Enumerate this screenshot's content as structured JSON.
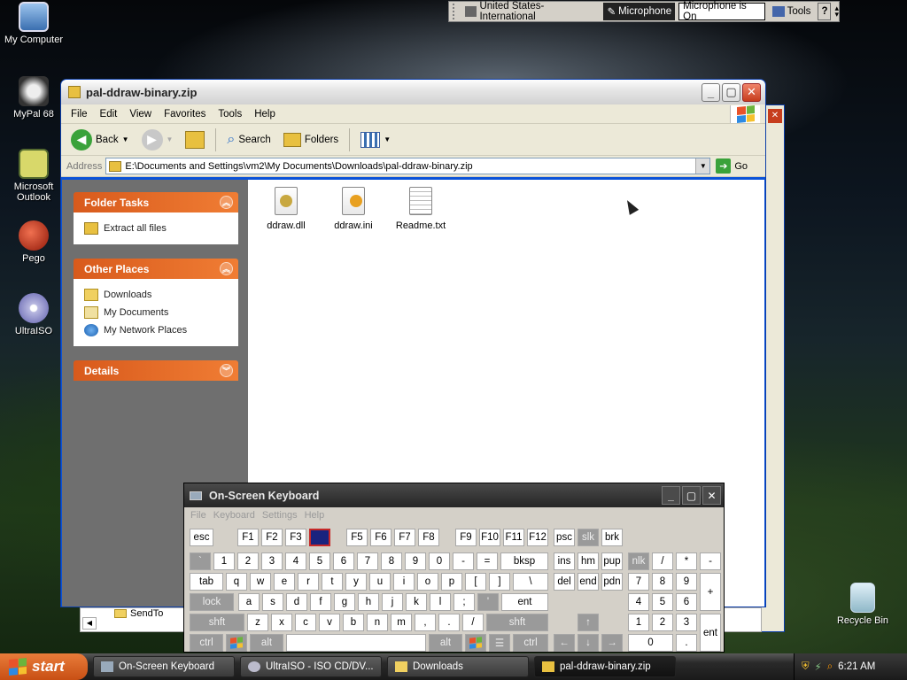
{
  "language_bar": {
    "language": "United States-International",
    "microphone_label": "Microphone",
    "microphone_status": "Microphone is On",
    "tools_label": "Tools",
    "help_glyph": "?"
  },
  "desktop": {
    "icons": [
      {
        "label": "My Computer",
        "icon": "computer-icon"
      },
      {
        "label": "MyPal 68",
        "icon": "mypal-icon"
      },
      {
        "label": "Microsoft Outlook",
        "icon": "outlook-icon"
      },
      {
        "label": "Pego",
        "icon": "pego-icon"
      },
      {
        "label": "UltraISO",
        "icon": "cd-icon"
      },
      {
        "label": "Recycle Bin",
        "icon": "recycle-bin-icon"
      }
    ]
  },
  "explorer": {
    "title": "pal-ddraw-binary.zip",
    "menu": [
      "File",
      "Edit",
      "View",
      "Favorites",
      "Tools",
      "Help"
    ],
    "toolbar": {
      "back": "Back",
      "search": "Search",
      "folders": "Folders"
    },
    "address_label": "Address",
    "address_value": "E:\\Documents and Settings\\vm2\\My Documents\\Downloads\\pal-ddraw-binary.zip",
    "go_label": "Go",
    "folder_tasks": {
      "title": "Folder Tasks",
      "items": [
        "Extract all files"
      ]
    },
    "other_places": {
      "title": "Other Places",
      "items": [
        "Downloads",
        "My Documents",
        "My Network Places"
      ]
    },
    "details": {
      "title": "Details"
    },
    "files": [
      {
        "name": "ddraw.dll",
        "icon": "dll-file-icon"
      },
      {
        "name": "ddraw.ini",
        "icon": "ini-file-icon"
      },
      {
        "name": "Readme.txt",
        "icon": "text-file-icon"
      }
    ]
  },
  "background_window": {
    "item": "SendTo"
  },
  "osk": {
    "title": "On-Screen Keyboard",
    "menu": [
      "File",
      "Keyboard",
      "Settings",
      "Help"
    ],
    "keys": {
      "esc": "esc",
      "f1": "F1",
      "f2": "F2",
      "f3": "F3",
      "f5": "F5",
      "f6": "F6",
      "f7": "F7",
      "f8": "F8",
      "f9": "F9",
      "f10": "F10",
      "f11": "F11",
      "f12": "F12",
      "psc": "psc",
      "slk": "slk",
      "brk": "brk",
      "grave": "`",
      "n1": "1",
      "n2": "2",
      "n3": "3",
      "n4": "4",
      "n5": "5",
      "n6": "6",
      "n7": "7",
      "n8": "8",
      "n9": "9",
      "n0": "0",
      "minus": "-",
      "equals": "=",
      "bksp": "bksp",
      "ins": "ins",
      "hm": "hm",
      "pup": "pup",
      "nlk": "nlk",
      "np_div": "/",
      "np_mul": "*",
      "np_sub": "-",
      "tab": "tab",
      "q": "q",
      "w": "w",
      "e": "e",
      "r": "r",
      "t": "t",
      "y": "y",
      "u": "u",
      "i": "i",
      "o": "o",
      "p": "p",
      "lbr": "[",
      "rbr": "]",
      "bslash": "\\",
      "del": "del",
      "end": "end",
      "pdn": "pdn",
      "np7": "7",
      "np8": "8",
      "np9": "9",
      "np_add": "+",
      "lock": "lock",
      "a": "a",
      "s": "s",
      "d": "d",
      "f": "f",
      "g": "g",
      "h": "h",
      "j": "j",
      "k": "k",
      "l": "l",
      "semi": ";",
      "quote": "'",
      "ent": "ent",
      "np4": "4",
      "np5": "5",
      "np6": "6",
      "shft": "shft",
      "z": "z",
      "x": "x",
      "c": "c",
      "v": "v",
      "b": "b",
      "n": "n",
      "m": "m",
      "comma": ",",
      "period": ".",
      "slash": "/",
      "shft_r": "shft",
      "np1": "1",
      "np2": "2",
      "np3": "3",
      "np_ent": "ent",
      "ctrl": "ctrl",
      "alt": "alt",
      "alt_r": "alt",
      "ctrl_r": "ctrl",
      "np0": "0",
      "np_dot": "."
    }
  },
  "taskbar": {
    "start": "start",
    "items": [
      {
        "label": "On-Screen Keyboard",
        "active": false
      },
      {
        "label": "UltraISO - ISO CD/DV...",
        "active": false
      },
      {
        "label": "Downloads",
        "active": false
      },
      {
        "label": "pal-ddraw-binary.zip",
        "active": true
      }
    ],
    "clock": "6:21 AM"
  }
}
